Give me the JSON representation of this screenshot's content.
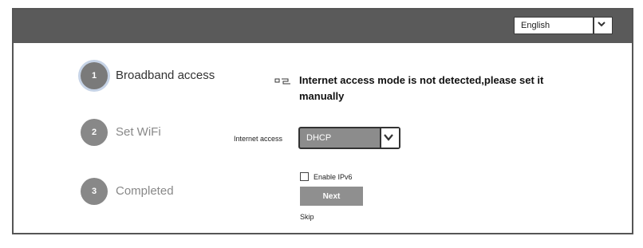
{
  "header": {
    "language": {
      "selected": "English",
      "icon": "chevron-down-icon"
    }
  },
  "steps": [
    {
      "number": "1",
      "label": "Broadband access",
      "active": true
    },
    {
      "number": "2",
      "label": "Set WiFi",
      "active": false
    },
    {
      "number": "3",
      "label": "Completed",
      "active": false
    }
  ],
  "main": {
    "notice_icon": "link-icon",
    "notice": "Internet access mode is not detected,please set it manually",
    "internet_access_label": "Internet access",
    "internet_access_value": "DHCP",
    "ipv6_label": "Enable IPv6",
    "ipv6_checked": false,
    "next_label": "Next",
    "skip_label": "Skip"
  },
  "colors": {
    "topbar": "#5a5a5a",
    "active_ring": "#c6d3e6",
    "button": "#8f8f8f"
  }
}
